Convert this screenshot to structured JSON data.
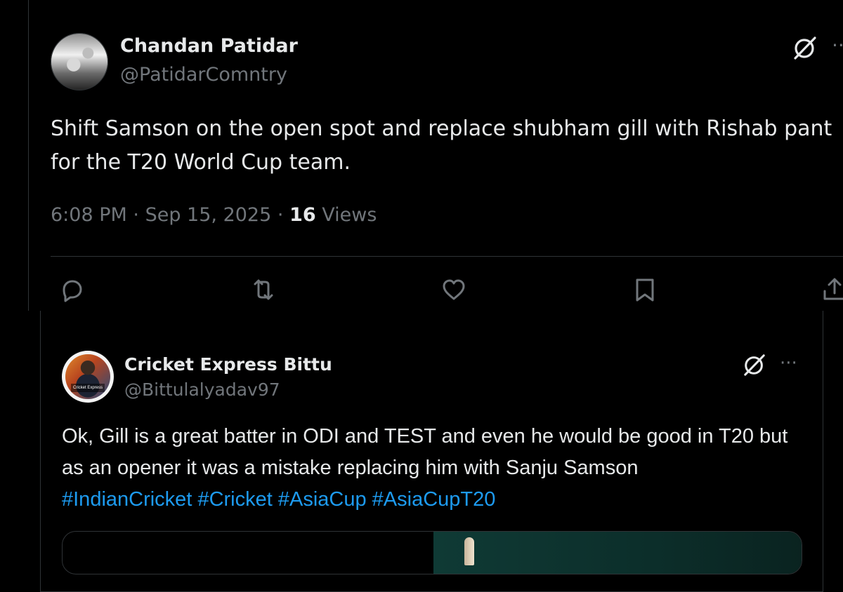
{
  "tweet": {
    "display_name": "Chandan Patidar",
    "handle": "@PatidarComntry",
    "text": "Shift Samson on the open spot and replace shubham gill with Rishab pant for the T20 World Cup team.",
    "time": "6:08 PM",
    "date": "Sep 15, 2025",
    "separator": "·",
    "views_count": "16",
    "views_label": "Views",
    "more_label": "···",
    "icons": {
      "grok": "grok-icon",
      "reply": "reply-icon",
      "retweet": "retweet-icon",
      "like": "heart-icon",
      "bookmark": "bookmark-icon",
      "share": "share-icon"
    }
  },
  "quoted": {
    "display_name": "Cricket Express Bittu",
    "handle": "@Bittulalyadav97",
    "avatar_badge": "Cricket Express",
    "text": "Ok, Gill is a great batter in ODI and TEST and even he would be good in T20 but as an opener it was a mistake replacing him with Sanju Samson",
    "hashtags": [
      "#IndianCricket",
      "#Cricket",
      "#AsiaCup",
      "#AsiaCupT20"
    ],
    "more_label": "···"
  },
  "colors": {
    "background": "#000000",
    "text_primary": "#e7e9ea",
    "text_secondary": "#71767b",
    "link": "#1d9bf0",
    "border": "#2f3336"
  }
}
